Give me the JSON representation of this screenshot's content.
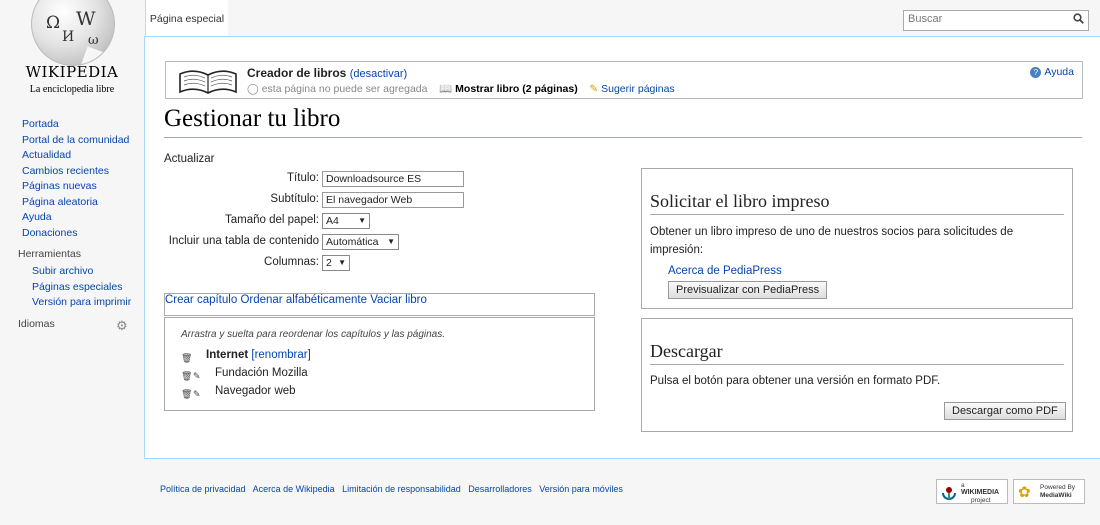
{
  "logo": {
    "title": "Wikipedia",
    "tagline": "La enciclopedia libre",
    "glyphs": [
      "Ω",
      "W",
      "И",
      "ω"
    ]
  },
  "nav": [
    "Portada",
    "Portal de la comunidad",
    "Actualidad",
    "Cambios recientes",
    "Páginas nuevas",
    "Página aleatoria",
    "Ayuda",
    "Donaciones"
  ],
  "tools_heading": "Herramientas",
  "tools": [
    "Subir archivo",
    "Páginas especiales",
    "Versión para imprimir"
  ],
  "languages_heading": "Idiomas",
  "tab": "Página especial",
  "search": {
    "placeholder": "Buscar"
  },
  "creator": {
    "title": "Creador de libros",
    "deactivate": "(desactivar)",
    "cannot_add": "esta página no puede ser agregada",
    "show_book": "Mostrar libro (2 páginas)",
    "suggest": "Sugerir páginas",
    "help": "Ayuda"
  },
  "heading": "Gestionar tu libro",
  "refresh": "Actualizar",
  "form": {
    "title_label": "Título:",
    "title_value": "Downloadsource ES",
    "subtitle_label": "Subtítulo:",
    "subtitle_value": "El navegador Web",
    "paper_label": "Tamaño del papel:",
    "paper_value": "A4",
    "toc_label": "Incluir una tabla de contenido",
    "toc_value": "Automática",
    "columns_label": "Columnas:",
    "columns_value": "2"
  },
  "actions": {
    "create_chapter": "Crear capítulo",
    "sort": "Ordenar alfabéticamente",
    "clear": "Vaciar libro"
  },
  "outline": {
    "hint": "Arrastra y suelta para reordenar los capítulos y las páginas.",
    "chapter": "Internet",
    "rename": "[renombrar]",
    "pages": [
      "Fundación Mozilla",
      "Navegador web"
    ]
  },
  "print_box": {
    "heading": "Solicitar el libro impreso",
    "text": "Obtener un libro impreso de uno de nuestros socios para solicitudes de impresión:",
    "about": "Acerca de PediaPress",
    "preview_button": "Previsualizar con PediaPress"
  },
  "download_box": {
    "heading": "Descargar",
    "text": "Pulsa el botón para obtener una versión en formato PDF.",
    "button": "Descargar como PDF"
  },
  "footer": [
    "Política de privacidad",
    "Acerca de Wikipedia",
    "Limitación de responsabilidad",
    "Desarrolladores",
    "Versión para móviles"
  ],
  "badges": {
    "wikimedia": [
      "a",
      "WIKIMEDIA",
      "project"
    ],
    "mediawiki": [
      "Powered By",
      "MediaWiki"
    ]
  }
}
